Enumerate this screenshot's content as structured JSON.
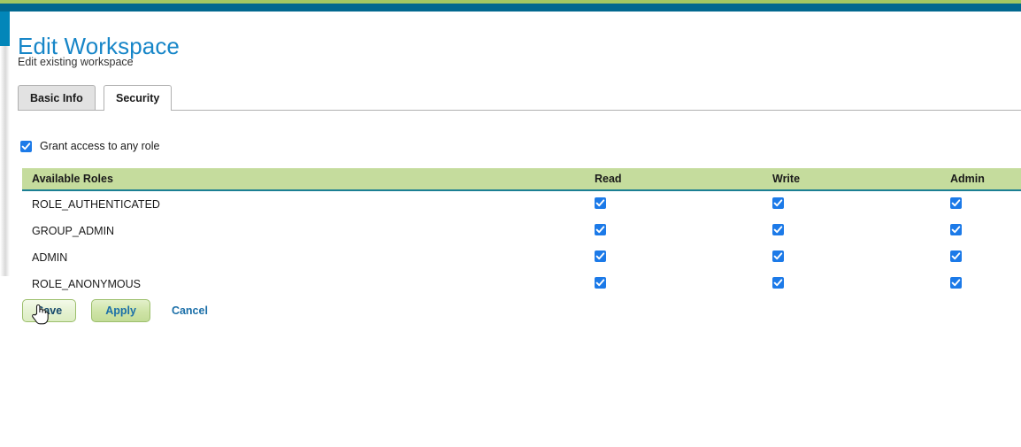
{
  "theme": {
    "accent_green": "#a3c862",
    "accent_teal": "#01688f",
    "title_blue": "#1786c8",
    "table_header_green": "#c5dc9d",
    "checkbox_blue": "#1c7ae8",
    "link_blue": "#1b6fa8"
  },
  "header": {
    "title": "Edit Workspace",
    "subtitle": "Edit existing workspace"
  },
  "tabs": [
    {
      "label": "Basic Info",
      "active": false
    },
    {
      "label": "Security",
      "active": true
    }
  ],
  "grant": {
    "label": "Grant access to any role",
    "checked": true,
    "icon": "checkbox-checked-icon"
  },
  "table": {
    "columns": [
      "Available Roles",
      "Read",
      "Write",
      "Admin"
    ],
    "rows": [
      {
        "role": "ROLE_AUTHENTICATED",
        "read": true,
        "write": true,
        "admin": true
      },
      {
        "role": "GROUP_ADMIN",
        "read": true,
        "write": true,
        "admin": true
      },
      {
        "role": "ADMIN",
        "read": true,
        "write": true,
        "admin": true
      },
      {
        "role": "ROLE_ANONYMOUS",
        "read": true,
        "write": true,
        "admin": true
      }
    ]
  },
  "actions": {
    "save_label": "Save",
    "apply_label": "Apply",
    "cancel_label": "Cancel"
  },
  "cursor": {
    "type": "pointing-hand-cursor"
  }
}
